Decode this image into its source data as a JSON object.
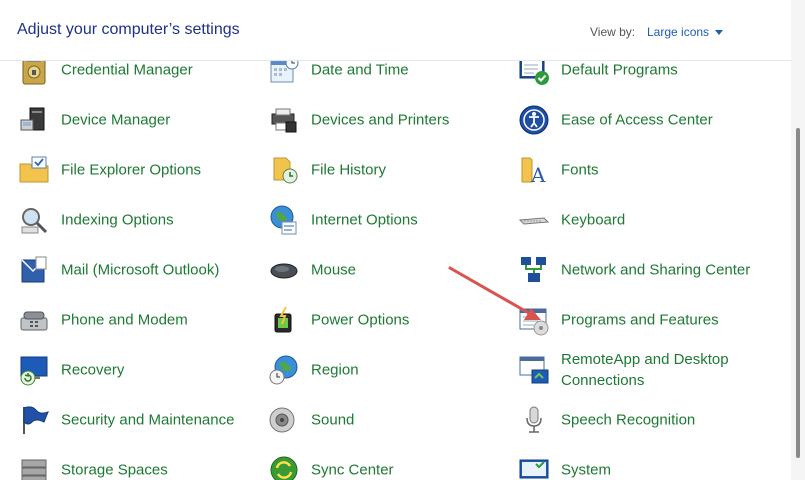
{
  "header": {
    "title": "Adjust your computer’s settings",
    "view_by_label": "View by:",
    "view_by_value": "Large icons"
  },
  "items": {
    "credential_manager": "Credential Manager",
    "date_and_time": "Date and Time",
    "default_programs": "Default Programs",
    "device_manager": "Device Manager",
    "devices_and_printers": "Devices and Printers",
    "ease_of_access": "Ease of Access Center",
    "file_explorer_options": "File Explorer Options",
    "file_history": "File History",
    "fonts": "Fonts",
    "indexing_options": "Indexing Options",
    "internet_options": "Internet Options",
    "keyboard": "Keyboard",
    "mail": "Mail (Microsoft Outlook)",
    "mouse": "Mouse",
    "network_sharing": "Network and Sharing Center",
    "phone_modem": "Phone and Modem",
    "power_options": "Power Options",
    "programs_features": "Programs and Features",
    "recovery": "Recovery",
    "region": "Region",
    "remoteapp": "RemoteApp and Desktop Connections",
    "security_maintenance": "Security and Maintenance",
    "sound": "Sound",
    "speech_recognition": "Speech Recognition",
    "storage_spaces": "Storage Spaces",
    "sync_center": "Sync Center",
    "system": "System"
  },
  "colors": {
    "title": "#1e3287",
    "link": "#1d7a33",
    "accent": "#1e5bb8",
    "annotation_arrow": "#d9534f"
  }
}
